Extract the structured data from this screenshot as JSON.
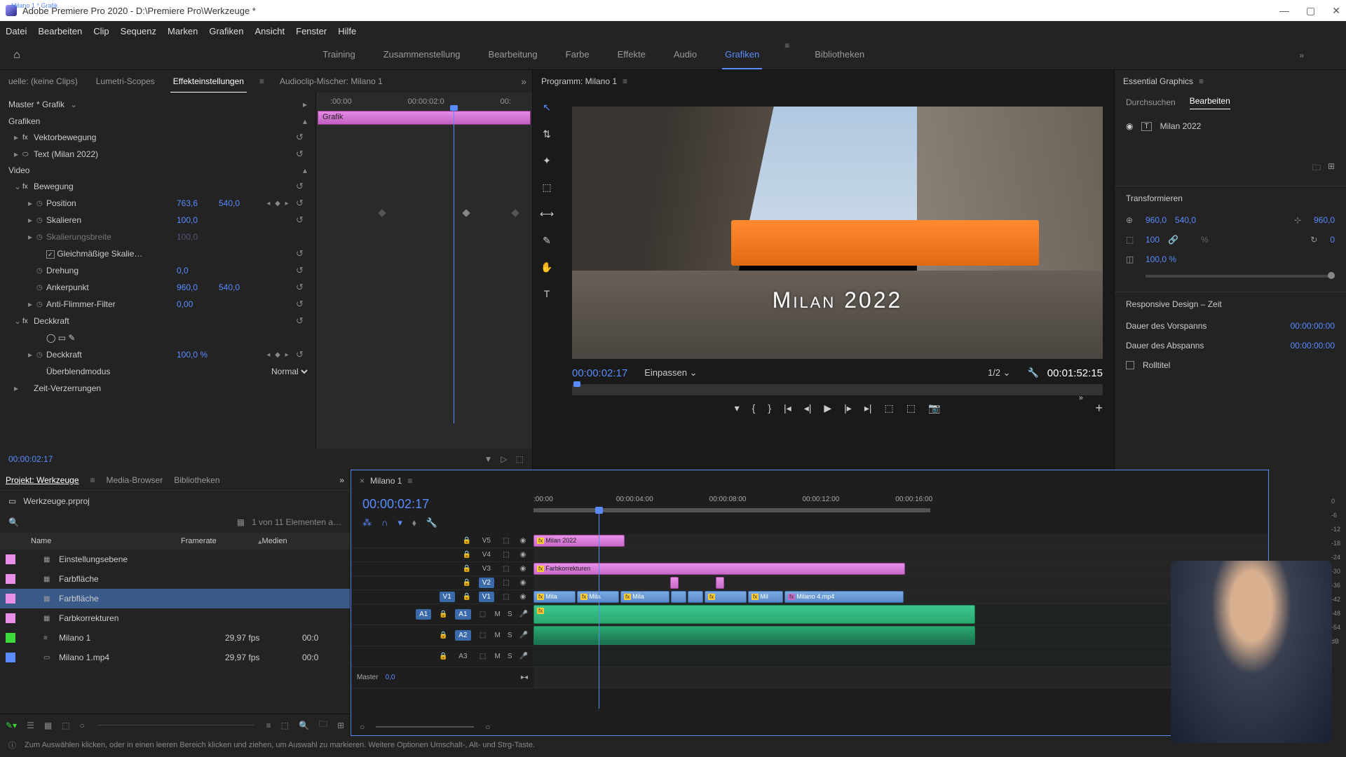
{
  "title": "Adobe Premiere Pro 2020 - D:\\Premiere Pro\\Werkzeuge *",
  "menu": [
    "Datei",
    "Bearbeiten",
    "Clip",
    "Sequenz",
    "Marken",
    "Grafiken",
    "Ansicht",
    "Fenster",
    "Hilfe"
  ],
  "workspaces": [
    "Training",
    "Zusammenstellung",
    "Bearbeitung",
    "Farbe",
    "Effekte",
    "Audio",
    "Grafiken",
    "Bibliotheken"
  ],
  "workspace_active": "Grafiken",
  "source_tabs": {
    "quelle": "uelle: (keine Clips)",
    "lumetri": "Lumetri-Scopes",
    "effects": "Effekteinstellungen",
    "mixer": "Audioclip-Mischer: Milano 1"
  },
  "effect": {
    "master": "Master * Grafik",
    "clip": "Milano 1 * Grafik",
    "ruler": {
      "t0": ":00:00",
      "t1": "00:00:02:0",
      "t2": "00:"
    },
    "clip_label": "Grafik",
    "sec_grafiken": "Grafiken",
    "vektor": "Vektorbewegung",
    "text": "Text (Milan 2022)",
    "sec_video": "Video",
    "bewegung": "Bewegung",
    "position": "Position",
    "pos_x": "763,6",
    "pos_y": "540,0",
    "skalieren": "Skalieren",
    "skal_v": "100,0",
    "skalbreite": "Skalierungsbreite",
    "skalb_v": "100,0",
    "gleich": "Gleichmäßige Skalie…",
    "drehung": "Drehung",
    "dreh_v": "0,0",
    "anker": "Ankerpunkt",
    "anker_x": "960,0",
    "anker_y": "540,0",
    "flimmer": "Anti-Flimmer-Filter",
    "flim_v": "0,00",
    "deckkraft": "Deckkraft",
    "deck_val": "Deckkraft",
    "deck_v": "100,0 %",
    "blend": "Überblendmodus",
    "blend_v": "Normal",
    "zeit": "Zeit-Verzerrungen",
    "footer_tc": "00:00:02:17"
  },
  "program": {
    "title": "Programm: Milano 1",
    "overlay_text": "Milan 2022",
    "tc": "00:00:02:17",
    "fit": "Einpassen",
    "zoom": "1/2",
    "dur": "00:01:52:15"
  },
  "eg": {
    "title": "Essential Graphics",
    "tab1": "Durchsuchen",
    "tab2": "Bearbeiten",
    "layer": "Milan 2022",
    "transform": "Transformieren",
    "pos_x": "960,0",
    "pos_y": "540,0",
    "anchor": "960,0",
    "scale": "100",
    "rot": "0",
    "pct": "%",
    "opacity": "100,0 %",
    "resp": "Responsive Design – Zeit",
    "intro": "Dauer des Vorspanns",
    "intro_v": "00:00:00:00",
    "outro": "Dauer des Abspanns",
    "outro_v": "00:00:00:00",
    "roll": "Rolltitel"
  },
  "project": {
    "tabs": {
      "proj": "Projekt: Werkzeuge",
      "media": "Media-Browser",
      "bib": "Bibliotheken"
    },
    "file": "Werkzeuge.prproj",
    "count": "1 von 11 Elementen a…",
    "cols": {
      "name": "Name",
      "fr": "Framerate",
      "med": "Medien"
    },
    "rows": [
      {
        "swatch": "#e890e8",
        "icon": "▦",
        "name": "Einstellungsebene",
        "fr": "",
        "med": ""
      },
      {
        "swatch": "#e890e8",
        "icon": "▦",
        "name": "Farbfläche",
        "fr": "",
        "med": ""
      },
      {
        "swatch": "#e890e8",
        "icon": "▦",
        "name": "Farbfläche",
        "fr": "",
        "med": "",
        "sel": true
      },
      {
        "swatch": "#e890e8",
        "icon": "▦",
        "name": "Farbkorrekturen",
        "fr": "",
        "med": ""
      },
      {
        "swatch": "#3adb3a",
        "icon": "≡",
        "name": "Milano 1",
        "fr": "29,97 fps",
        "med": "00:0"
      },
      {
        "swatch": "#5a8cff",
        "icon": "▭",
        "name": "Milano 1.mp4",
        "fr": "29,97 fps",
        "med": "00:0"
      }
    ]
  },
  "timeline": {
    "name": "Milano 1",
    "tc": "00:00:02:17",
    "ruler": [
      ":00:00",
      "00:00:04:00",
      "00:00:08:00",
      "00:00:12:00",
      "00:00:16:00"
    ],
    "tracks": {
      "v5": "V5",
      "v4": "V4",
      "v3": "V3",
      "v2": "V2",
      "v1": "V1",
      "a1": "A1",
      "a2": "A2",
      "a3": "A3",
      "master": "Master",
      "master_v": "0,0"
    },
    "clips": {
      "title": "Milan 2022",
      "farbk": "Farbkorrekturen",
      "m1": "Mila",
      "m2": "Mila",
      "m3": "Mila",
      "m4": "Mil",
      "m5": "Milano 4.mp4"
    }
  },
  "meters": [
    "0",
    "-6",
    "-12",
    "-18",
    "-24",
    "-30",
    "-36",
    "-42",
    "-48",
    "-54",
    "dB"
  ],
  "meter_btn": "S",
  "status": "Zum Auswählen klicken, oder in einen leeren Bereich klicken und ziehen, um Auswahl zu markieren. Weitere Optionen Umschalt-, Alt- und Strg-Taste."
}
